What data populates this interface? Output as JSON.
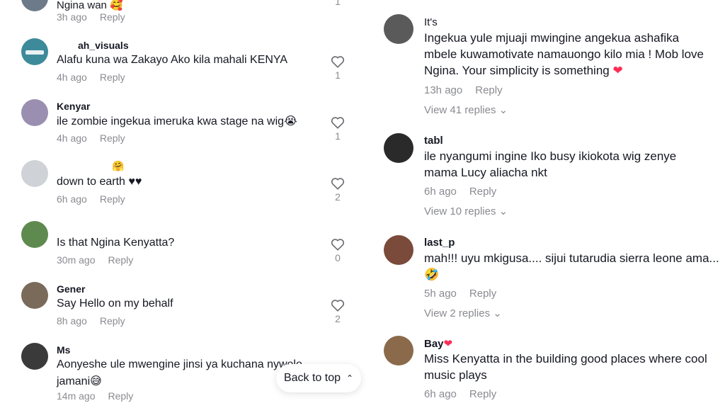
{
  "colors": {
    "muted": "#8a8b91",
    "text": "#161823",
    "accent": "#fe2c55"
  },
  "left_comments": [
    {
      "username": "Ngina wan",
      "text": "",
      "time": "3h ago",
      "reply_label": "Reply",
      "likes": "1"
    },
    {
      "username": "ah_visuals",
      "text": "Alafu kuna wa Zakayo Ako kila mahali KENYA",
      "time": "4h ago",
      "reply_label": "Reply",
      "likes": "1"
    },
    {
      "username": "Kenyar",
      "text": "ile zombie ingekua imeruka kwa stage na wig",
      "time": "4h ago",
      "reply_label": "Reply",
      "likes": "1"
    },
    {
      "username": "",
      "text": "down to earth ♥♥",
      "time": "6h ago",
      "reply_label": "Reply",
      "likes": "2"
    },
    {
      "username": "",
      "text": "Is that Ngina Kenyatta?",
      "time": "30m ago",
      "reply_label": "Reply",
      "likes": "0"
    },
    {
      "username": "Gener",
      "text": "Say Hello on my behalf",
      "time": "8h ago",
      "reply_label": "Reply",
      "likes": "2"
    },
    {
      "username": "Ms",
      "text": "Aonyeshe ule mwengine jinsi ya kuchana nywele jamani",
      "time": "14m ago",
      "reply_label": "Reply",
      "likes": ""
    }
  ],
  "right_comments": [
    {
      "username": "It's",
      "text": "Ingekua yule mjuaji mwingine angekua ashafika mbele kuwamotivate namauongo kilo mia ! Mob love Ngina. Your simplicity is something",
      "time": "13h ago",
      "reply_label": "Reply",
      "view_replies": "View 41 replies"
    },
    {
      "username": "tabl",
      "text": "ile nyangumi ingine Iko busy ikiokota wig zenye mama Lucy aliacha nkt",
      "time": "6h ago",
      "reply_label": "Reply",
      "view_replies": "View 10 replies"
    },
    {
      "username": "last_p",
      "text": "mah!!! uyu mkigusa.... sijui tutarudia sierra leone ama...",
      "time": "5h ago",
      "reply_label": "Reply",
      "view_replies": "View 2 replies"
    },
    {
      "username": "Bay",
      "text": "Miss Kenyatta in the building good places where cool music plays",
      "time": "6h ago",
      "reply_label": "Reply",
      "view_replies": ""
    }
  ],
  "back_to_top": {
    "label": "Back to top"
  }
}
